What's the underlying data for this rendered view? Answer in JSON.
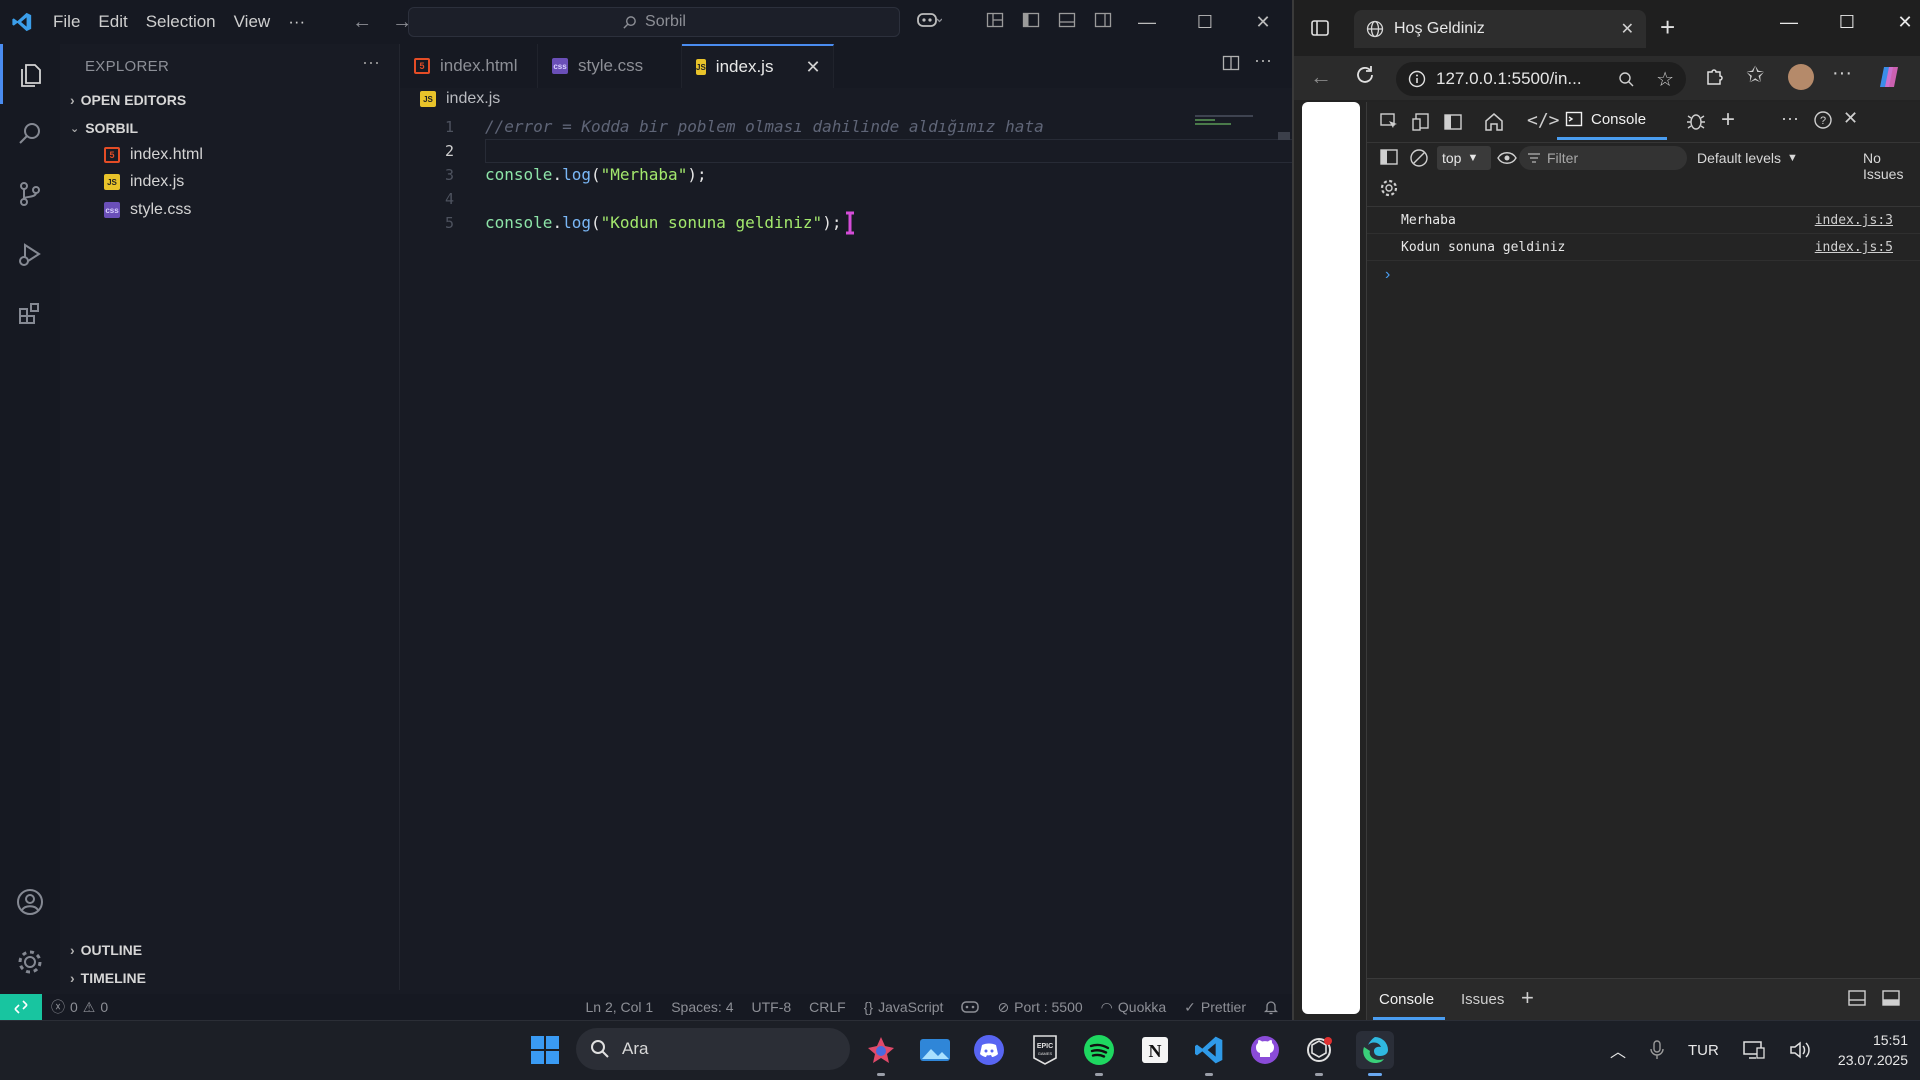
{
  "vscode": {
    "menu": [
      "File",
      "Edit",
      "Selection",
      "View",
      "···"
    ],
    "command_center": "Sorbil",
    "sidebar": {
      "title": "EXPLORER",
      "open_editors": "OPEN EDITORS",
      "folder": "SORBIL",
      "files": [
        {
          "name": "index.html",
          "type": "html"
        },
        {
          "name": "index.js",
          "type": "js"
        },
        {
          "name": "style.css",
          "type": "css"
        }
      ],
      "outline": "OUTLINE",
      "timeline": "TIMELINE"
    },
    "tabs": [
      {
        "label": "index.html",
        "type": "html",
        "active": false
      },
      {
        "label": "style.css",
        "type": "css",
        "active": false
      },
      {
        "label": "index.js",
        "type": "js",
        "active": true
      }
    ],
    "breadcrumb": "index.js",
    "code": {
      "line_numbers": [
        "1",
        "2",
        "3",
        "4",
        "5"
      ],
      "line1_comment": "//error = Kodda bir poblem olması dahilinde aldığımız hata",
      "line3": {
        "obj": "console",
        "dot": ".",
        "method": "log",
        "open": "(",
        "str": "\"Merhaba\"",
        "close": ");"
      },
      "line5": {
        "obj": "console",
        "dot": ".",
        "method": "log",
        "open": "(",
        "str": "\"Kodun sonuna geldiniz\"",
        "close": ");"
      }
    },
    "status": {
      "errors": "0",
      "warnings": "0",
      "position": "Ln 2, Col 1",
      "spaces": "Spaces: 4",
      "encoding": "UTF-8",
      "eol": "CRLF",
      "language": "JavaScript",
      "port": "Port : 5500",
      "quokka": "Quokka",
      "prettier": "Prettier"
    }
  },
  "browser": {
    "tab_title": "Hoş Geldiniz",
    "address": "127.0.0.1:5500/in...",
    "devtools": {
      "active_tab": "Console",
      "context": "top",
      "filter_placeholder": "Filter",
      "levels": "Default levels",
      "issues": "No Issues",
      "logs": [
        {
          "message": "Merhaba",
          "source": "index.js:3"
        },
        {
          "message": "Kodun sonuna geldiniz",
          "source": "index.js:5"
        }
      ],
      "drawer_tabs": [
        "Console",
        "Issues"
      ]
    }
  },
  "taskbar": {
    "search_placeholder": "Ara",
    "language": "TUR",
    "time": "15:51",
    "date": "23.07.2025"
  },
  "colors": {
    "vscode_bg": "#181b24",
    "accent": "#4a8cf0",
    "string": "#a3e86d",
    "remote_indicator": "#18c5a0"
  }
}
